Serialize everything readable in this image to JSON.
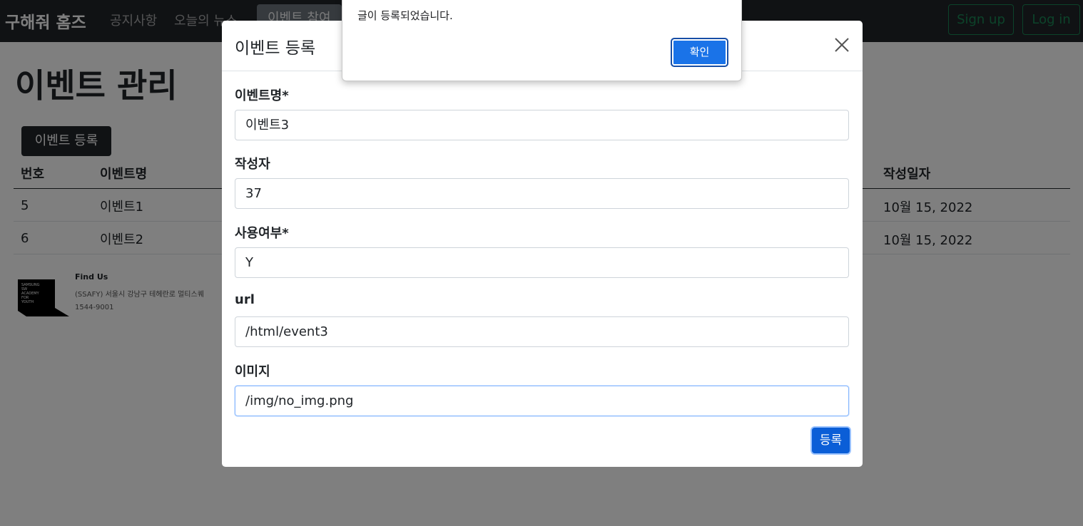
{
  "navbar": {
    "brand": "구해줘 홈즈",
    "links": [
      "공지사항",
      "오늘의 뉴스",
      "이벤트 참여"
    ],
    "signup": "Sign up",
    "login": "Log in"
  },
  "page": {
    "title": "이벤트 관리",
    "register_button": "이벤트 등록",
    "table": {
      "headers": {
        "number": "번호",
        "name": "이벤트명",
        "date": "작성일자"
      },
      "rows": [
        {
          "number": "5",
          "name": "이벤트1",
          "date": "10월 15, 2022"
        },
        {
          "number": "6",
          "name": "이벤트2",
          "date": "10월 15, 2022"
        }
      ]
    }
  },
  "footer": {
    "logo_text": "SAMSUNG SW ACADEMY FOR YOUTH",
    "title": "Find Us",
    "address": "(SSAFY) 서울시 강남구 테헤란로 멀티스퀘",
    "phone": "1544-9001"
  },
  "modal": {
    "title": "이벤트 등록",
    "fields": [
      {
        "label": "이벤트명*",
        "value": "이벤트3"
      },
      {
        "label": "작성자",
        "value": "37"
      },
      {
        "label": "사용여부*",
        "value": "Y"
      },
      {
        "label": "url",
        "value": "/html/event3"
      },
      {
        "label": "이미지",
        "value": "/img/no_img.png"
      }
    ],
    "submit": "등록"
  },
  "alert": {
    "message": "글이 등록되었습니다.",
    "ok": "확인"
  },
  "colors": {
    "navbar": "#212529",
    "primary": "#0b5ed7",
    "success": "#198754",
    "dialog_button": "#1a73e8"
  }
}
